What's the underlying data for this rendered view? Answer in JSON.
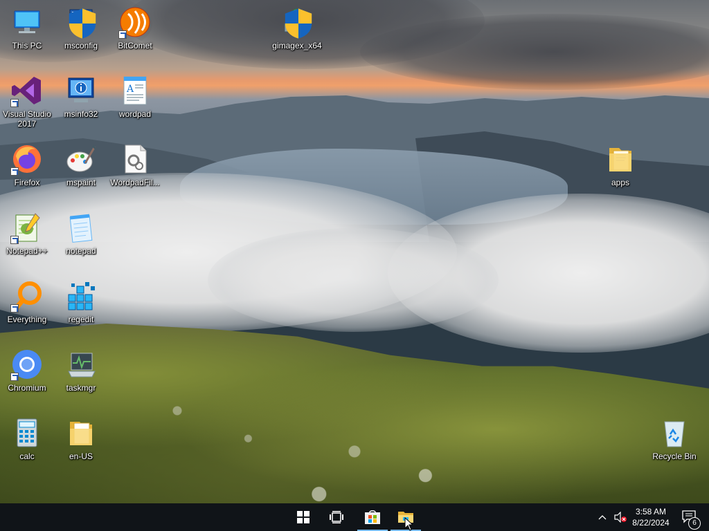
{
  "desktop": {
    "icons": [
      {
        "label": "This PC"
      },
      {
        "label": "msconfig"
      },
      {
        "label": "BitComet"
      },
      {
        "label": "gimagex_x64"
      },
      {
        "label": "Visual Studio 2017"
      },
      {
        "label": "msinfo32"
      },
      {
        "label": "wordpad"
      },
      {
        "label": "Firefox"
      },
      {
        "label": "mspaint"
      },
      {
        "label": "WordpadFil..."
      },
      {
        "label": "apps"
      },
      {
        "label": "Notepad++"
      },
      {
        "label": "notepad"
      },
      {
        "label": "Everything"
      },
      {
        "label": "regedit"
      },
      {
        "label": "Chromium"
      },
      {
        "label": "taskmgr"
      },
      {
        "label": "calc"
      },
      {
        "label": "en-US"
      },
      {
        "label": "Recycle Bin"
      }
    ]
  },
  "taskbar": {
    "start_icon": "windows-logo-icon",
    "task_view_icon": "task-view-icon",
    "store_icon": "store-icon",
    "explorer_icon": "file-explorer-icon",
    "accent": "#76b9ed",
    "tray": {
      "time": "3:58 AM",
      "date": "8/22/2024",
      "notification_count": "6"
    }
  }
}
